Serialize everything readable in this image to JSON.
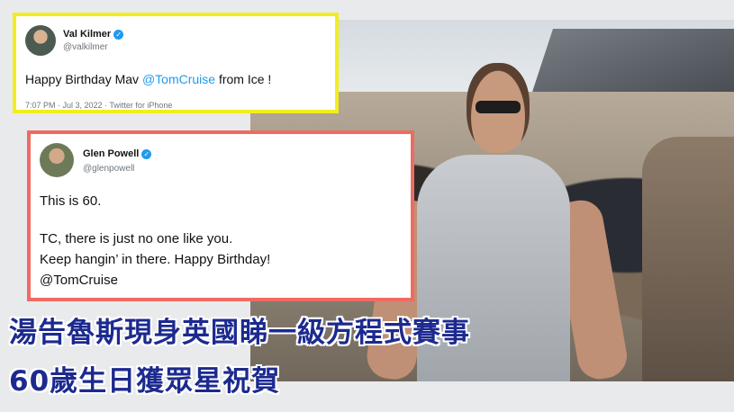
{
  "tweet1": {
    "name": "Val Kilmer",
    "handle": "@valkilmer",
    "text_before": "Happy Birthday Mav ",
    "mention": "@TomCruise",
    "text_after": " from Ice !",
    "meta": "7:07 PM · Jul 3, 2022 · Twitter for iPhone"
  },
  "tweet2": {
    "name": "Glen Powell",
    "handle": "@glenpowell",
    "line1": "This is 60.",
    "line2": "TC, there is just no one like you.",
    "line3": "Keep hangin’ in there. Happy Birthday!",
    "mention": "@TomCruise"
  },
  "caption": {
    "line1": "湯告魯斯現身英國睇一級方程式賽事",
    "line2": "60歲生日獲眾星祝賀"
  },
  "colors": {
    "tweet1_border": "#f2ee1e",
    "tweet2_border": "#ef6b62",
    "mention": "#1d9bf0",
    "caption": "#1c2a8f"
  },
  "icons": {
    "verified": "verified-badge-icon"
  }
}
